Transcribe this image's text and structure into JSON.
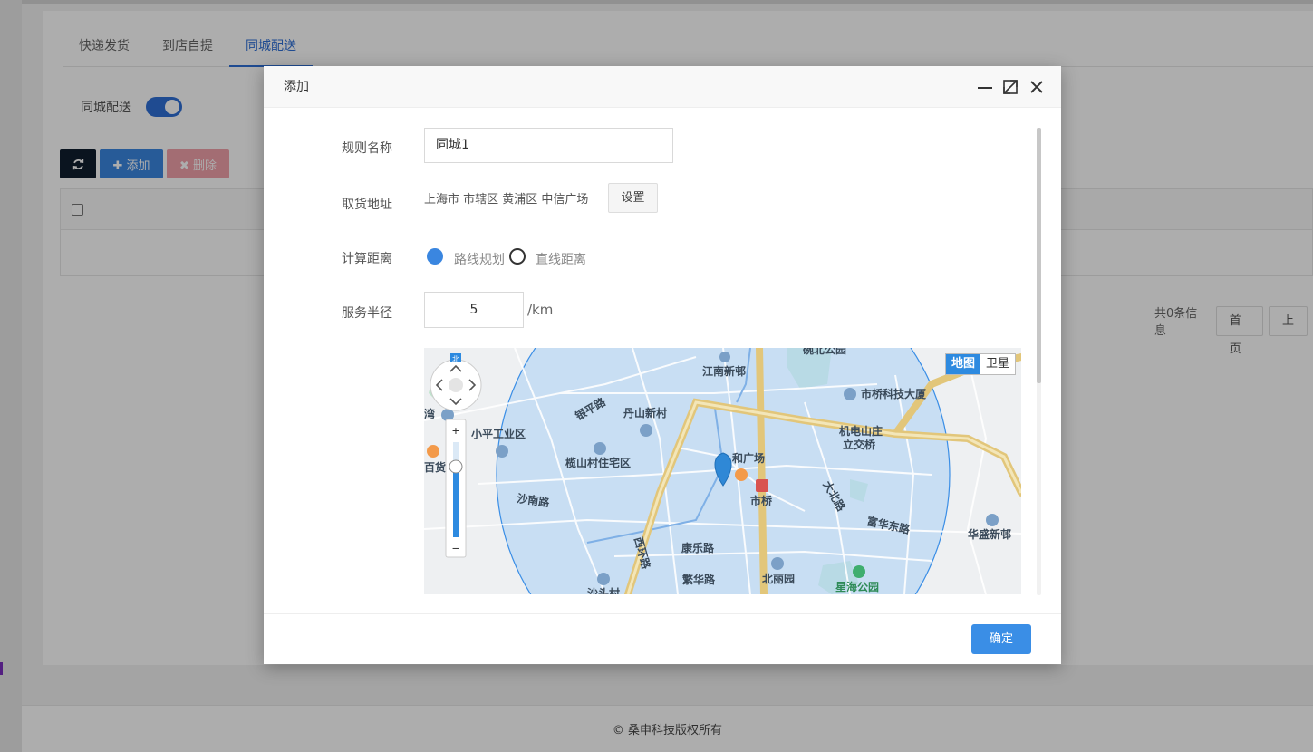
{
  "page": {
    "tabs": [
      "快递发货",
      "到店自提",
      "同城配送"
    ],
    "active_tab": "同城配送",
    "switch_label": "同城配送",
    "switch_on": true,
    "toolbar": {
      "add_label": "✚ 添加",
      "delete_label": "✖ 删除"
    },
    "pager": {
      "info": "共0条信息",
      "first": "首页",
      "prev": "上"
    },
    "footer": "© 桑申科技版权所有"
  },
  "modal": {
    "title": "添加",
    "rule_name_label": "规则名称",
    "rule_name_value": "同城1",
    "address_label": "取货地址",
    "address_value": "上海市 市辖区 黄浦区 中信广场",
    "set_button": "设置",
    "distance_label": "计算距离",
    "distance_options": [
      "路线规划",
      "直线距离"
    ],
    "distance_selected": "路线规划",
    "radius_label": "服务半径",
    "radius_value": "5",
    "radius_unit": "/km",
    "map": {
      "map_type_buttons": [
        "地图",
        "卫星"
      ],
      "map_type_selected": "地图",
      "zoom_in": "+",
      "zoom_out": "−",
      "compass_north": "北",
      "place_labels": [
        "碗北公园",
        "江南新邨",
        "市桥科技大厦",
        "银平路",
        "丹山新村",
        "湾",
        "小平工业区",
        "机电山庄",
        "立交桥",
        "和广场",
        "百货",
        "榄山村住宅区",
        "市桥",
        "大北路",
        "沙南路",
        "富华东路",
        "华盛新邨",
        "西环路",
        "康乐路",
        "北丽园",
        "繁华路",
        "星海公园",
        "沙头村"
      ]
    },
    "confirm_button": "确定"
  },
  "colors": {
    "accent": "#2f6fd6",
    "primary_button": "#3a8ee6",
    "danger_button": "#f1a1aa",
    "dark_button": "#0f1e2e",
    "service_circle_fill": "#b4d4f2",
    "road_yellow": "#e2c67a"
  }
}
